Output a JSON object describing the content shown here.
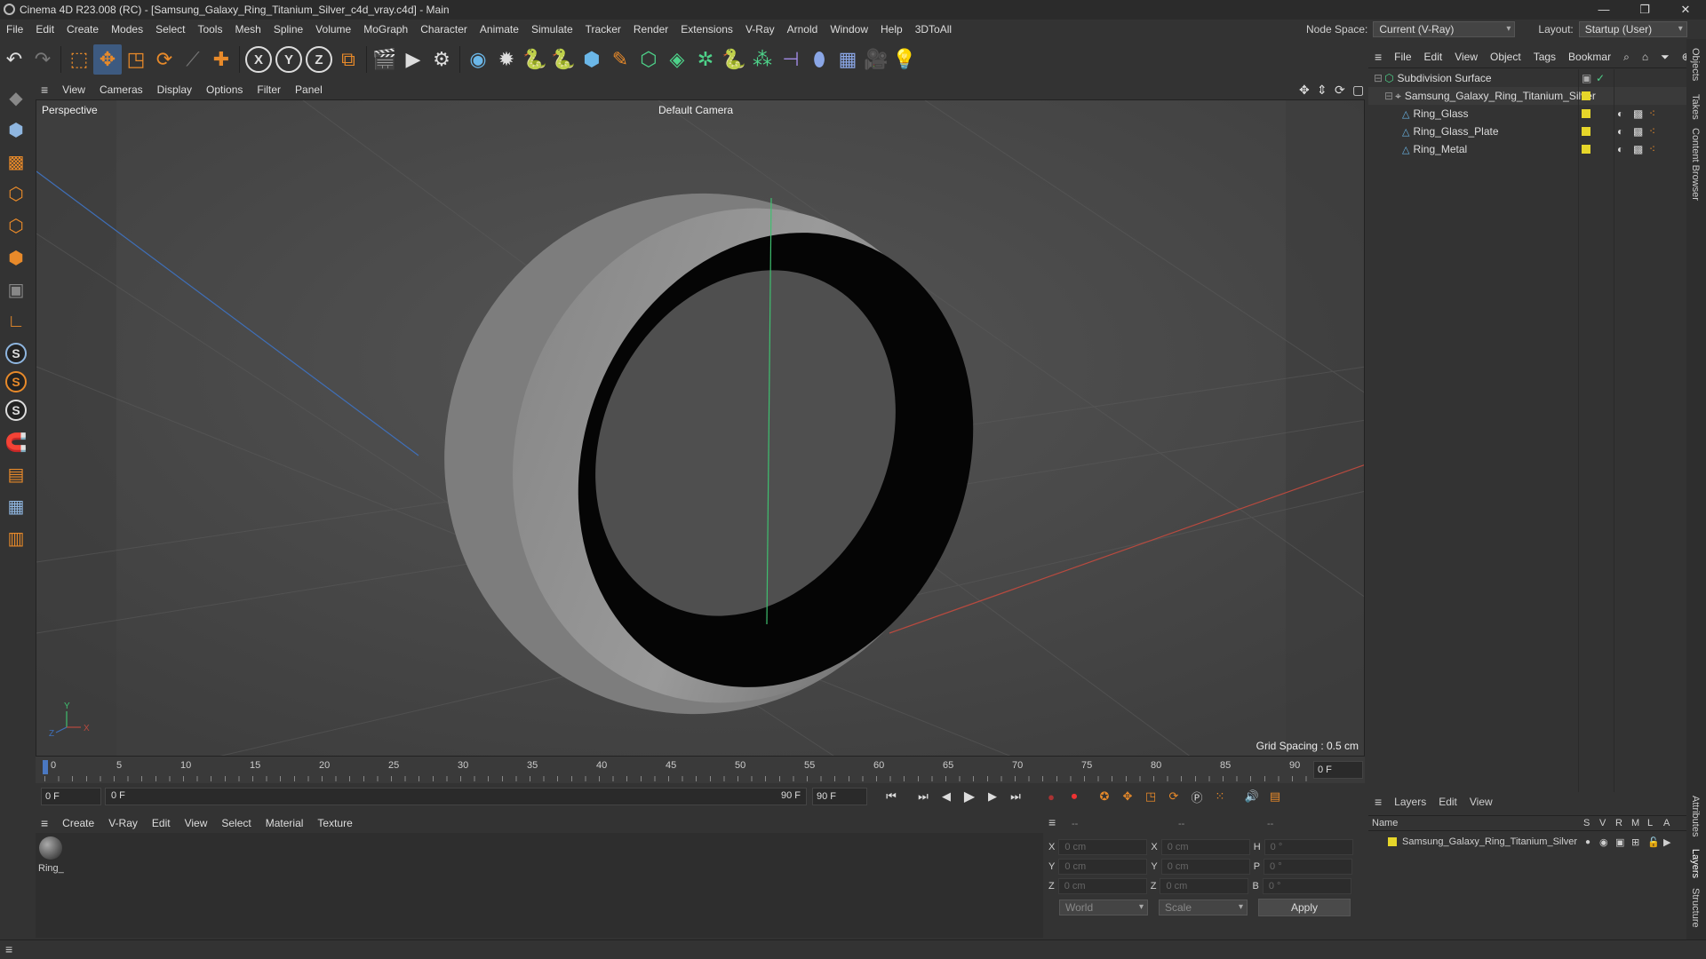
{
  "window": {
    "title": "Cinema 4D R23.008 (RC) - [Samsung_Galaxy_Ring_Titanium_Silver_c4d_vray.c4d] - Main"
  },
  "menubar": {
    "items": [
      "File",
      "Edit",
      "Create",
      "Modes",
      "Select",
      "Tools",
      "Mesh",
      "Spline",
      "Volume",
      "MoGraph",
      "Character",
      "Animate",
      "Simulate",
      "Tracker",
      "Render",
      "Extensions",
      "V-Ray",
      "Arnold",
      "Window",
      "Help",
      "3DToAll"
    ],
    "node_space_label": "Node Space:",
    "node_space_value": "Current (V-Ray)",
    "layout_label": "Layout:",
    "layout_value": "Startup (User)"
  },
  "viewport": {
    "menu": [
      "View",
      "Cameras",
      "Display",
      "Options",
      "Filter",
      "Panel"
    ],
    "label": "Perspective",
    "camera": "Default Camera",
    "grid_spacing": "Grid Spacing : 0.5 cm"
  },
  "timeline": {
    "ticks": [
      "0",
      "5",
      "10",
      "15",
      "20",
      "25",
      "30",
      "35",
      "40",
      "45",
      "50",
      "55",
      "60",
      "65",
      "70",
      "75",
      "80",
      "85",
      "90"
    ],
    "frame_field": "0 F",
    "start": "0 F",
    "range_start": "0 F",
    "range_end": "90 F",
    "end": "90 F"
  },
  "material": {
    "menu": [
      "Create",
      "V-Ray",
      "Edit",
      "View",
      "Select",
      "Material",
      "Texture"
    ],
    "item_label": "Ring_"
  },
  "coords": {
    "header_left": "--",
    "header_mid": "--",
    "header_right": "--",
    "rows": [
      {
        "a": "X",
        "av": "0 cm",
        "b": "X",
        "bv": "0 cm",
        "c": "H",
        "cv": "0 °"
      },
      {
        "a": "Y",
        "av": "0 cm",
        "b": "Y",
        "bv": "0 cm",
        "c": "P",
        "cv": "0 °"
      },
      {
        "a": "Z",
        "av": "0 cm",
        "b": "Z",
        "bv": "0 cm",
        "c": "B",
        "cv": "0 °"
      }
    ],
    "world": "World",
    "scale": "Scale",
    "apply": "Apply"
  },
  "objects": {
    "menu": [
      "File",
      "Edit",
      "View",
      "Object",
      "Tags",
      "Bookmar"
    ],
    "items": [
      "Subdivision Surface",
      "Samsung_Galaxy_Ring_Titanium_Silver",
      "Ring_Glass",
      "Ring_Glass_Plate",
      "Ring_Metal"
    ]
  },
  "layers": {
    "menu": [
      "Layers",
      "Edit",
      "View"
    ],
    "col_name": "Name",
    "cols": [
      "S",
      "V",
      "R",
      "M",
      "L",
      "A"
    ],
    "item": "Samsung_Galaxy_Ring_Titanium_Silver"
  },
  "sidetabs": [
    "Objects",
    "Takes",
    "Content Browser",
    "Attributes",
    "Layers",
    "Structure"
  ],
  "colors": {
    "accent": "#3d5a80",
    "layer_yellow": "#e6d62a",
    "viewport_bg": "#4a4a4a"
  }
}
